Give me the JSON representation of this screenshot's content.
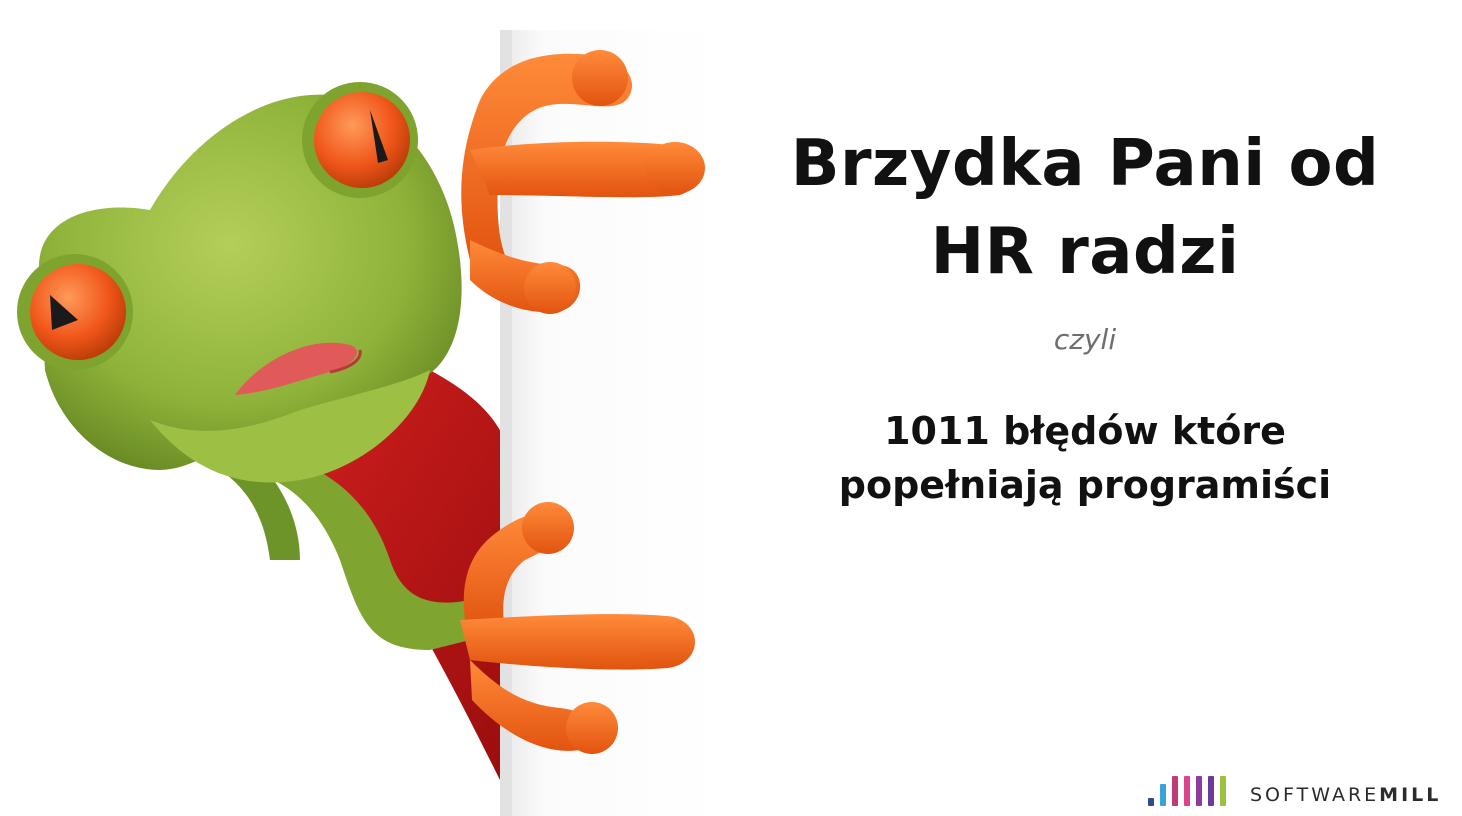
{
  "slide": {
    "title_line1": "Brzydka Pani od",
    "title_line2": "HR radzi",
    "connector": "czyli",
    "subtitle_line1": "1011 błędów które",
    "subtitle_line2": "popełniają programiści"
  },
  "logo": {
    "name_light": "SOFTWARE",
    "name_bold": "MILL",
    "icon": "softwaremill-bars-icon",
    "bar_colors": [
      "#2d4b8e",
      "#3aa3d6",
      "#c03a7a",
      "#d9448a",
      "#8e3ba0",
      "#6a3aa0",
      "#9bc23a"
    ]
  },
  "illustration": {
    "icon": "frog-peeking-behind-board",
    "colors": {
      "frog_green": "#8fb33a",
      "frog_orange": "#f26a1e",
      "cape_red": "#c01818",
      "board": "#f7f7f7"
    }
  }
}
